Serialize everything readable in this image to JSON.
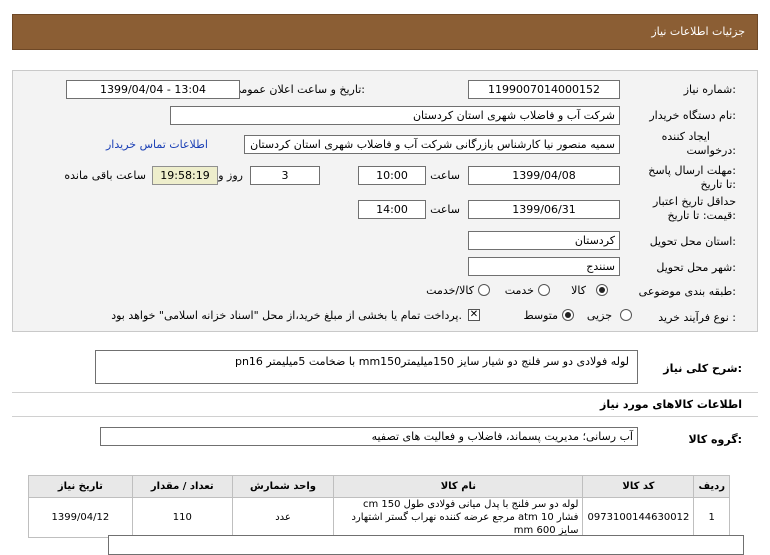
{
  "header": {
    "title": "جزئیات اطلاعات نیاز"
  },
  "form": {
    "need_number_label": "شماره نیاز:",
    "need_number": "1199007014000152",
    "announce_label": "تاریخ و ساعت اعلان عمومی:",
    "announce_value": "1399/04/04 - 13:04",
    "buyer_label": "نام دستگاه خریدار:",
    "buyer_value": "شرکت آب و فاضلاب شهری استان کردستان",
    "creator_label_1": "ایجاد کننده",
    "creator_label_2": "درخواست:",
    "creator_value": "سمیه منصور نیا کارشناس بازرگانی شرکت آب و فاضلاب شهری استان کردستان",
    "contact_link": "اطلاعات تماس خریدار",
    "deadline_label_1": "مهلت ارسال پاسخ:",
    "deadline_label_2": "تا تاریخ:",
    "deadline_date": "1399/04/08",
    "time_label": "ساعت",
    "deadline_time": "10:00",
    "days_value": "3",
    "days_label": "روز و",
    "remaining_value": "19:58:19",
    "remaining_label": "ساعت باقی مانده",
    "validity_label_1": "حداقل تاریخ اعتبار",
    "validity_label_2": "قیمت: تا تاریخ:",
    "validity_date": "1399/06/31",
    "validity_time_label": "ساعت",
    "validity_time": "14:00",
    "province_label": "استان محل تحویل:",
    "province_value": "کردستان",
    "city_label": "شهر محل تحویل:",
    "city_value": "سنندج",
    "category_label": "طبقه بندی موضوعی:",
    "category_options": [
      "کالا",
      "خدمت",
      "کالا/خدمت"
    ],
    "category_selected": "کالا",
    "process_label": "نوع فرآیند خرید :",
    "process_options": [
      "جزیی",
      "متوسط"
    ],
    "process_selected": "متوسط",
    "payment_note": "پرداخت تمام یا بخشی از مبلغ خرید،از محل \"اسناد خزانه اسلامی\" خواهد بود."
  },
  "description": {
    "label": "شرح کلی نیاز:",
    "text": "لوله فولادی دو سر فلنج دو شیار سایز 150میلیمترmm150 با ضخامت 5میلیمتر pn16"
  },
  "goods_section": {
    "title": "اطلاعات کالاهای مورد نیاز"
  },
  "goods_group": {
    "label": "گروه کالا:",
    "value": "آب رسانی؛ مدیریت پسماند، فاضلاب و فعالیت های تصفیه"
  },
  "table": {
    "headers": [
      "ردیف",
      "کد کالا",
      "نام کالا",
      "واحد شمارش",
      "تعداد / مقدار",
      "تاریخ نیاز"
    ],
    "rows": [
      {
        "row": "1",
        "code": "0973100144630012",
        "name": "لوله دو سر فلنج با پدل میانی فولادی طول 150 cm فشار 10 atm مرجع عرضه کننده نهراب گستر اشتهارد سایز 600 mm",
        "unit": "عدد",
        "qty": "110",
        "date": "1399/04/12"
      }
    ]
  }
}
